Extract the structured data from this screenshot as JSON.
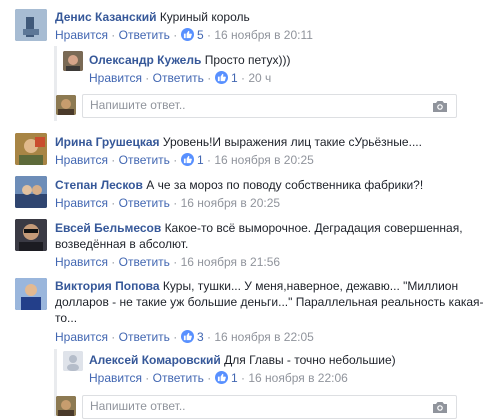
{
  "reply_placeholder": "Напишите ответ..",
  "comments": [
    {
      "author": "Денис Казанский",
      "text": "Куриный король",
      "like": "Нравится",
      "reply": "Ответить",
      "likes": "5",
      "time": "16 ноября в 20:11"
    },
    {
      "author": "Олександр Кужель",
      "text": "Просто петух)))",
      "like": "Нравится",
      "reply": "Ответить",
      "likes": "1",
      "time": "20 ч"
    },
    {
      "author": "Ирина Грушецкая",
      "text": "Уровень!И выражения лиц такие сУрьёзные....",
      "like": "Нравится",
      "reply": "Ответить",
      "likes": "1",
      "time": "16 ноября в 20:25"
    },
    {
      "author": "Степан Лесков",
      "text": "А че за мороз по поводу собственника фабрики?!",
      "like": "Нравится",
      "reply": "Ответить",
      "time": "16 ноября в 20:25"
    },
    {
      "author": "Евсей Бельмесов",
      "text_line1": "Какое-то всё выморочное. Деградация совершенная,",
      "text_line2": "возведённая в абсолют.",
      "like": "Нравится",
      "reply": "Ответить",
      "time": "16 ноября в 21:56"
    },
    {
      "author": "Виктория Попова",
      "text_line1": "Куры, тушки... У меня,наверное, дежавю... \"Миллион",
      "text_line2": "долларов - не такие уж большие деньги...\" Параллельная реальность какая-",
      "text_line3": "то...",
      "like": "Нравится",
      "reply": "Ответить",
      "likes": "3",
      "time": "16 ноября в 22:05"
    },
    {
      "author": "Алексей Комаровский",
      "text": "Для Главы - точно небольшие)",
      "like": "Нравится",
      "reply": "Ответить",
      "likes": "1",
      "time": "16 ноября в 22:06"
    }
  ],
  "sep": "·",
  "colors": {
    "link": "#365899",
    "meta": "#90949c",
    "action": "#4267b2",
    "like_badge": "#5890ff",
    "thread_bar": "#e9ebee"
  }
}
